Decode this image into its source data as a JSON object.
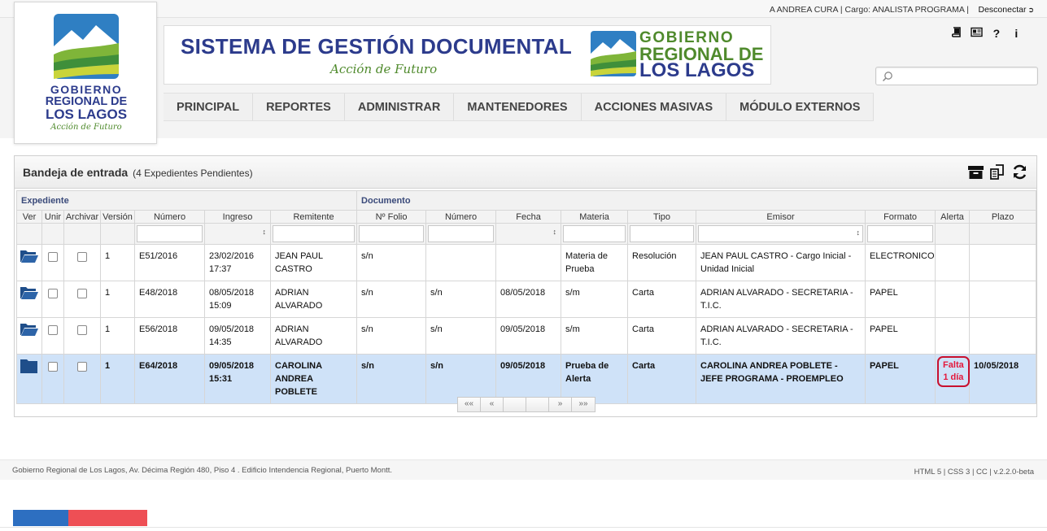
{
  "topbar": {
    "user_info": "A ANDREA CURA | Cargo: ANALISTA PROGRAMA |",
    "logout_label": "Desconectar"
  },
  "logo": {
    "line1": "GOBIERNO",
    "line2": "REGIONAL DE",
    "line3": "LOS LAGOS",
    "slogan": "Acción de Futuro"
  },
  "banner": {
    "title": "SISTEMA DE GESTIÓN DOCUMENTAL",
    "slogan": "Acción de Futuro",
    "brand_line1": "GOBIERNO",
    "brand_line2": "REGIONAL DE",
    "brand_line3": "LOS LAGOS"
  },
  "tool_icons": [
    "book-icon",
    "news-icon",
    "help-icon",
    "info-icon"
  ],
  "tool_glyphs": {
    "help": "?",
    "info": "i"
  },
  "search": {
    "value": "",
    "placeholder": ""
  },
  "menu": [
    "PRINCIPAL",
    "REPORTES",
    "ADMINISTRAR",
    "MANTENEDORES",
    "ACCIONES MASIVAS",
    "MÓDULO EXTERNOS"
  ],
  "inbox": {
    "title": "Bandeja de entrada",
    "subtitle": "(4 Expedientes Pendientes)",
    "group_expediente": "Expediente",
    "group_documento": "Documento",
    "columns": [
      "Ver",
      "Unir",
      "Archivar",
      "Versión",
      "Número",
      "Ingreso",
      "Remitente",
      "Nº Folio",
      "Número",
      "Fecha",
      "Materia",
      "Tipo",
      "Emisor",
      "Formato",
      "Alerta",
      "Plazo"
    ],
    "rows": [
      {
        "version": "1",
        "numero": "E51/2016",
        "ingreso": "23/02/2016 17:37",
        "remitente": "JEAN PAUL CASTRO",
        "folio": "s/n",
        "doc_numero": "",
        "fecha": "",
        "materia": "Materia de Prueba",
        "tipo": "Resolución",
        "emisor": "JEAN PAUL CASTRO - Cargo Inicial - Unidad Inicial",
        "formato": "ELECTRONICO",
        "alerta": "",
        "plazo": ""
      },
      {
        "version": "1",
        "numero": "E48/2018",
        "ingreso": "08/05/2018 15:09",
        "remitente": "ADRIAN ALVARADO",
        "folio": "s/n",
        "doc_numero": "s/n",
        "fecha": "08/05/2018",
        "materia": "s/m",
        "tipo": "Carta",
        "emisor": "ADRIAN ALVARADO - SECRETARIA - T.I.C.",
        "formato": "PAPEL",
        "alerta": "",
        "plazo": ""
      },
      {
        "version": "1",
        "numero": "E56/2018",
        "ingreso": "09/05/2018 14:35",
        "remitente": "ADRIAN ALVARADO",
        "folio": "s/n",
        "doc_numero": "s/n",
        "fecha": "09/05/2018",
        "materia": "s/m",
        "tipo": "Carta",
        "emisor": "ADRIAN ALVARADO - SECRETARIA - T.I.C.",
        "formato": "PAPEL",
        "alerta": "",
        "plazo": ""
      },
      {
        "version": "1",
        "numero": "E64/2018",
        "ingreso": "09/05/2018 15:31",
        "remitente": "CAROLINA ANDREA POBLETE",
        "folio": "s/n",
        "doc_numero": "s/n",
        "fecha": "09/05/2018",
        "materia": "Prueba de Alerta",
        "tipo": "Carta",
        "emisor": "CAROLINA ANDREA POBLETE - JEFE PROGRAMA - PROEMPLEO",
        "formato": "PAPEL",
        "alerta": "Falta 1 día",
        "plazo": "10/05/2018"
      }
    ]
  },
  "pager": [
    "««",
    "«",
    "",
    "",
    "»",
    "»»"
  ],
  "footer": {
    "address": "Gobierno Regional de Los Lagos, Av. Décima Región 480, Piso 4 . Edificio Intendencia Regional, Puerto Montt.",
    "tech": "HTML 5 | CSS 3 | CC | v.2.2.0-beta"
  },
  "colors": {
    "brand_blue": "#2c3b8c",
    "brand_green": "#4f8a2c",
    "selected_row": "#cfe2f8",
    "alert_red": "#e4173b",
    "gov_bar_blue": "#2d6fc1",
    "gov_bar_red": "#ee4f55"
  }
}
